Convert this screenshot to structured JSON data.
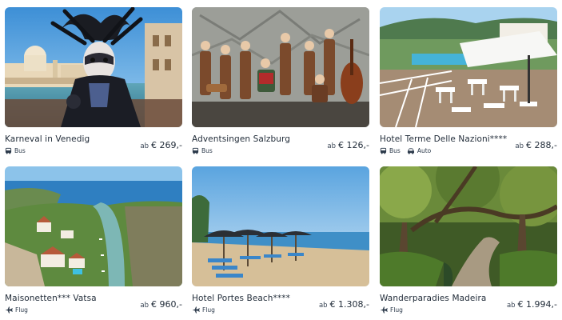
{
  "offers": [
    {
      "title": "Karneval in Venedig",
      "price_prefix": "ab",
      "price": "€ 269,-",
      "transport": [
        {
          "label": "Bus",
          "icon": "bus-icon"
        }
      ]
    },
    {
      "title": "Adventsingen Salzburg",
      "price_prefix": "ab",
      "price": "€ 126,-",
      "transport": [
        {
          "label": "Bus",
          "icon": "bus-icon"
        }
      ]
    },
    {
      "title": "Hotel Terme Delle Nazioni****",
      "price_prefix": "ab",
      "price": "€ 288,-",
      "transport": [
        {
          "label": "Bus",
          "icon": "bus-icon"
        },
        {
          "label": "Auto",
          "icon": "car-icon"
        }
      ]
    },
    {
      "title": "Maisonetten*** Vatsa",
      "price_prefix": "ab",
      "price": "€ 960,-",
      "transport": [
        {
          "label": "Flug",
          "icon": "plane-icon"
        }
      ]
    },
    {
      "title": "Hotel Portes Beach****",
      "price_prefix": "ab",
      "price": "€ 1.308,-",
      "transport": [
        {
          "label": "Flug",
          "icon": "plane-icon"
        }
      ]
    },
    {
      "title": "Wanderparadies Madeira",
      "price_prefix": "ab",
      "price": "€ 1.994,-",
      "transport": [
        {
          "label": "Flug",
          "icon": "plane-icon"
        }
      ]
    }
  ],
  "colors": {
    "text": "#1f2a37",
    "icon": "#2c3a4b"
  }
}
